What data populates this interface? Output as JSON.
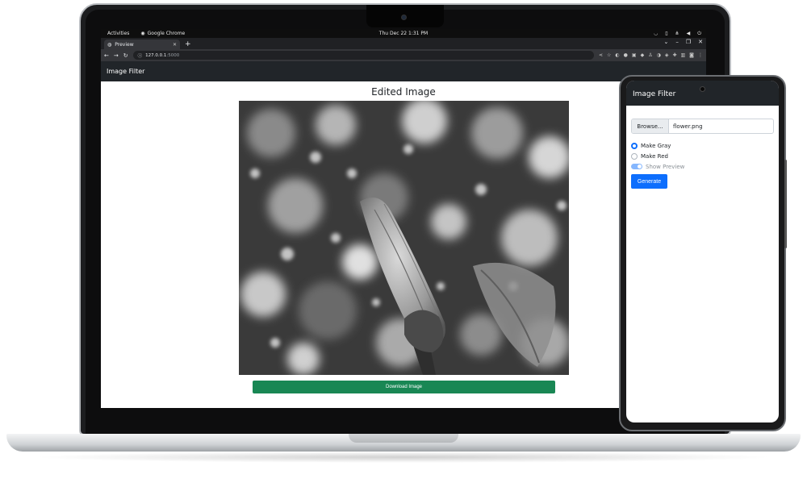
{
  "topbar": {
    "activities": "Activities",
    "app_name": "Google Chrome",
    "clock": "Thu Dec 22  1:31 PM"
  },
  "browser": {
    "tab_title": "Preview",
    "url_host": "127.0.0.1",
    "url_port": ":5000"
  },
  "laptop_app": {
    "nav_title": "Image Filter",
    "heading": "Edited Image",
    "download_label": "Download Image"
  },
  "phone_app": {
    "nav_title": "Image Filter",
    "browse_label": "Browse...",
    "file_name": "flower.png",
    "options": [
      "Make Gray",
      "Make Red"
    ],
    "selected_option": "Make Gray",
    "preview_toggle_label": "Show Preview",
    "preview_toggle_on": true,
    "generate_label": "Generate"
  },
  "colors": {
    "navbar": "#212529",
    "download_button": "#198754",
    "primary_button": "#0d6efd",
    "chrome_dark": "#202124"
  }
}
